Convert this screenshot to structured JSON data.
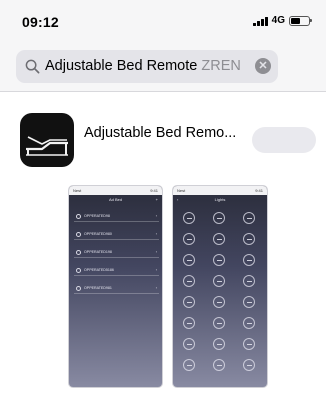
{
  "status_bar": {
    "time": "09:12",
    "network": "4G",
    "battery_level": 0.55,
    "signal_bars": 4
  },
  "search": {
    "query": "Adjustable Bed Remote",
    "hint": " ZREN",
    "clear_icon": "xmark-circle-icon",
    "search_icon": "magnifying-glass-icon"
  },
  "result": {
    "app_name": "Adjustable Bed Remo...",
    "app_icon": "adjustable-bed-icon",
    "button_label": "",
    "screenshots": [
      {
        "status_left": "Nest",
        "status_right": "9:41",
        "header_title": "Ad Bed",
        "header_action": "+",
        "devices": [
          "OPPERATED98",
          "OPPERATED980",
          "OPPERATED198",
          "OPPERATED5186",
          "OPPERATED981"
        ]
      },
      {
        "status_left": "Nest",
        "status_right": "9:41",
        "header_title": "Lights",
        "header_back": "‹",
        "button_count": 24
      }
    ]
  },
  "colors": {
    "status_bg": "#f6f6f7",
    "search_field_bg": "#e4e4e9",
    "hint_text": "#8e8e93",
    "get_button_bg": "#e9e9ee",
    "app_icon_bg": "#111111"
  }
}
